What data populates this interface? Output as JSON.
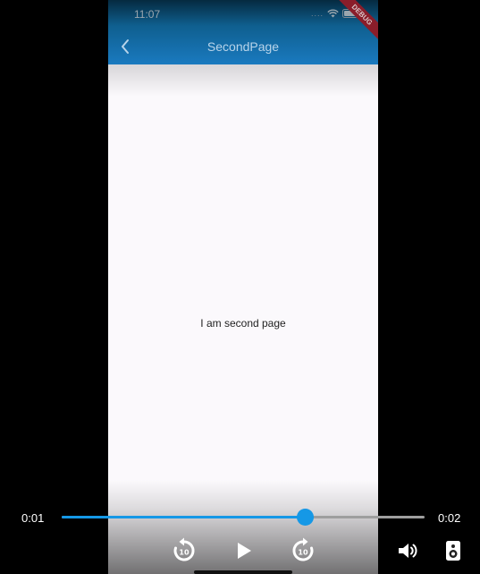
{
  "status_bar": {
    "time": "11:07",
    "dots": "....",
    "debug_label": "DEBUG"
  },
  "app_bar": {
    "title": "SecondPage"
  },
  "content": {
    "text": "I am second page"
  },
  "player": {
    "position": "0:01",
    "duration": "0:02",
    "progress_percent": 67,
    "rewind_seconds": "10",
    "forward_seconds": "10"
  },
  "colors": {
    "app_bar": "#1a7ac0",
    "accent": "#1598e6",
    "page_background": "#fbf9fc",
    "debug_banner": "#8a1d2a"
  },
  "icons": {
    "back": "chevron-left-icon",
    "rewind": "replay-10-icon",
    "play": "play-icon",
    "forward": "forward-10-icon",
    "volume": "volume-icon",
    "speaker": "speaker-icon"
  }
}
